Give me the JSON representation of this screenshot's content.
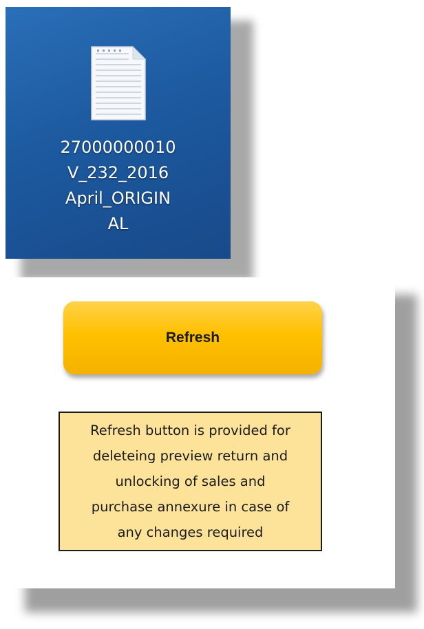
{
  "desktop": {
    "file_icon": "document-file-icon",
    "file_name_lines": [
      "27000000010",
      "V_232_2016",
      "April_ORIGIN",
      "AL"
    ]
  },
  "panel": {
    "refresh_button_label": "Refresh",
    "note_lines": [
      "Refresh button is provided for",
      "deleteing  preview return and",
      "unlocking of sales and",
      "purchase annexure in case of",
      "any changes required"
    ]
  },
  "colors": {
    "desktop_background": "#1d5aa0",
    "button_fill": "#ffc000",
    "note_fill": "#fde39a"
  }
}
